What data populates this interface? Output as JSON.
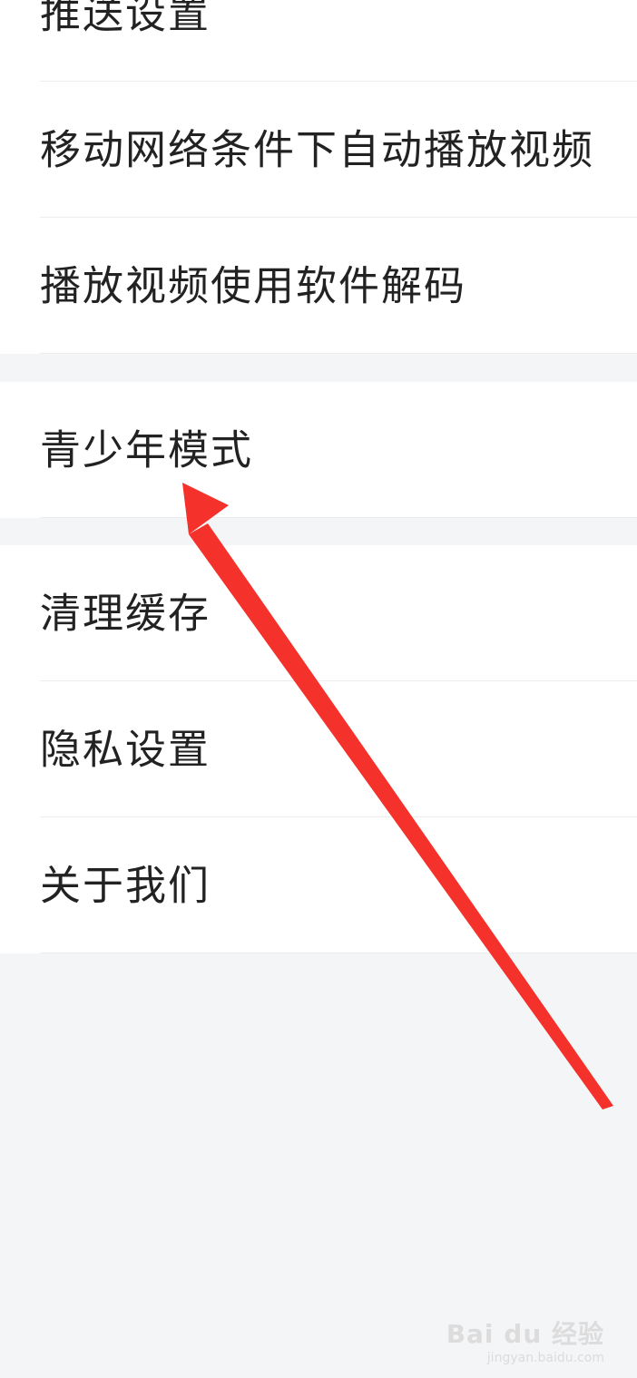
{
  "settings": {
    "group1": [
      {
        "label": "推送设置"
      },
      {
        "label": "移动网络条件下自动播放视频"
      },
      {
        "label": "播放视频使用软件解码"
      }
    ],
    "group2": [
      {
        "label": "青少年模式"
      }
    ],
    "group3": [
      {
        "label": "清理缓存"
      },
      {
        "label": "隐私设置"
      },
      {
        "label": "关于我们"
      }
    ]
  },
  "annotation": {
    "type": "red-arrow",
    "color": "#f5312b",
    "target": "青少年模式"
  },
  "watermark": {
    "brand": "Bai du 经验",
    "url": "jingyan.baidu.com"
  }
}
